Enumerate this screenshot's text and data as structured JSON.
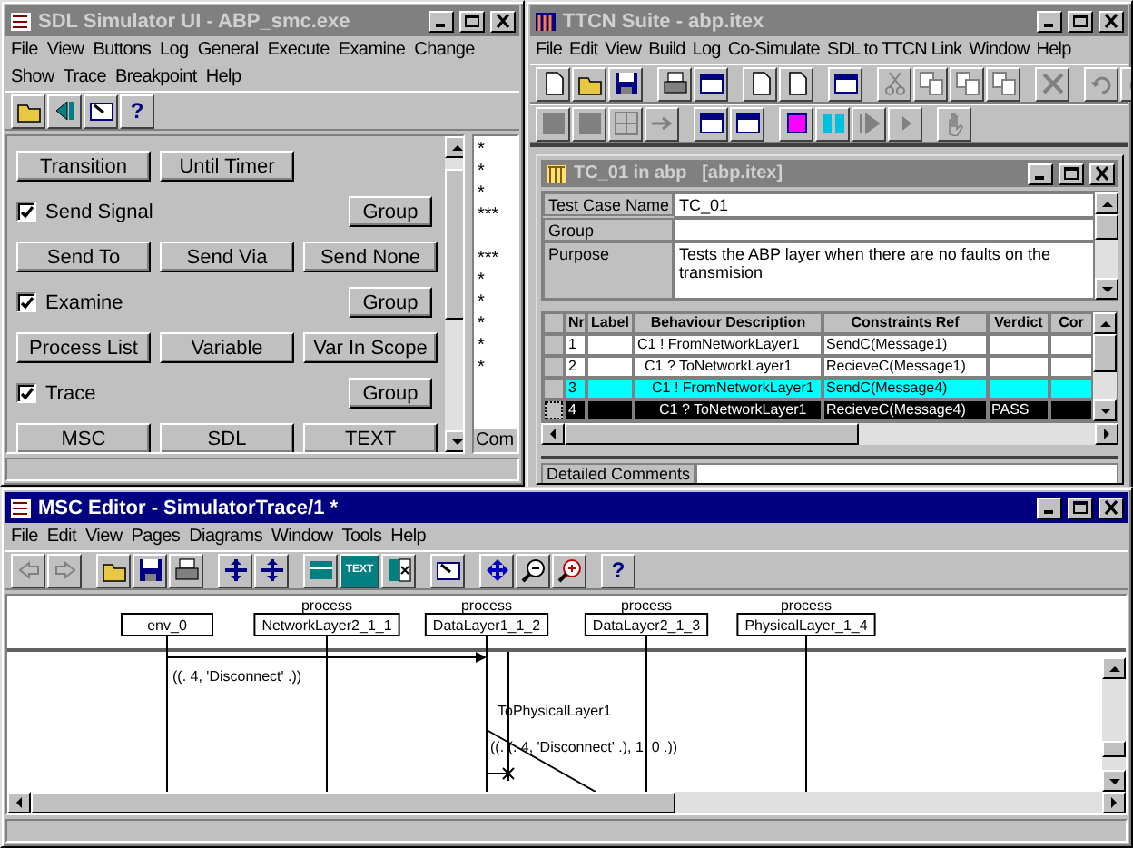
{
  "sdl_window": {
    "title": "SDL Simulator UI - ABP_smc.exe",
    "menu_rows": [
      [
        "File",
        "View",
        "Buttons",
        "Log",
        "General",
        "Execute",
        "Examine",
        "Change"
      ],
      [
        "Show",
        "Trace",
        "Breakpoint",
        "Help"
      ]
    ],
    "help_glyph": "?",
    "rows": [
      {
        "kind": "buttons",
        "buttons": [
          "Transition",
          "Until Timer"
        ]
      },
      {
        "kind": "check",
        "label": "Send Signal",
        "checked": true,
        "button": "Group"
      },
      {
        "kind": "buttons",
        "buttons": [
          "Send To",
          "Send Via",
          "Send None"
        ]
      },
      {
        "kind": "check",
        "label": "Examine",
        "checked": true,
        "button": "Group"
      },
      {
        "kind": "buttons",
        "buttons": [
          "Process List",
          "Variable",
          "Var In Scope"
        ]
      },
      {
        "kind": "check",
        "label": "Trace",
        "checked": true,
        "button": "Group"
      },
      {
        "kind": "buttons",
        "buttons": [
          "MSC",
          "SDL",
          "TEXT"
        ]
      }
    ],
    "log_text": "*\n*\n*\n***\n\n***\n*\n*\n*\n*\n*",
    "log_tab": "Com"
  },
  "ttcn_window": {
    "title": "TTCN Suite - abp.itex",
    "menu": [
      "File",
      "Edit",
      "View",
      "Build",
      "Log",
      "Co-Simulate",
      "SDL to TTCN Link",
      "Window",
      "Help"
    ],
    "test_case": {
      "title": "TC_01 in abp   [abp.itex]",
      "fields": [
        {
          "label": "Test Case Name",
          "value": "TC_01"
        },
        {
          "label": "Group"
        },
        {
          "label": "Purpose",
          "value": "Tests the ABP layer when there are no faults on the transmision"
        }
      ],
      "columns": [
        "Nr",
        "Label",
        "Behaviour Description",
        "Constraints Ref",
        "Verdict",
        "Cor"
      ],
      "rows": [
        {
          "nr": "1",
          "behaviour": "C1 ! FromNetworkLayer1",
          "constraints": "SendC(Message1)",
          "selected": false,
          "marked": false,
          "children": [
            {
              "nr": "2",
              "behaviour": "C1 ? ToNetworkLayer1",
              "constraints": "RecieveC(Message1)",
              "selected": false,
              "marked": false,
              "children": [
                {
                  "nr": "3",
                  "behaviour": "C1 ! FromNetworkLayer1",
                  "constraints": "SendC(Message4)",
                  "selected": false,
                  "marked": true,
                  "children": [
                    {
                      "nr": "4",
                      "behaviour": "C1 ? ToNetworkLayer1",
                      "constraints": "RecieveC(Message4)",
                      "verdict": "PASS",
                      "selected": true,
                      "marked": false
                    }
                  ]
                }
              ]
            }
          ]
        }
      ],
      "comments_label": "Detailed Comments"
    }
  },
  "msc_window": {
    "title": "MSC Editor - SimulatorTrace/1 *",
    "menu": [
      "File",
      "Edit",
      "View",
      "Pages",
      "Diagrams",
      "Window",
      "Tools",
      "Help"
    ],
    "text_tool_label": "TEXT",
    "help_glyph": "?",
    "instances": [
      {
        "name": "env_0"
      },
      {
        "type": "process",
        "name": "NetworkLayer2_1_1"
      },
      {
        "type": "process",
        "name": "DataLayer1_1_2"
      },
      {
        "type": "process",
        "name": "DataLayer2_1_3"
      },
      {
        "type": "process",
        "name": "PhysicalLayer_1_4"
      }
    ],
    "messages": [
      {
        "kind": "horizontal",
        "params": "((. 4, 'Disconnect' .))"
      },
      {
        "kind": "sloped",
        "name": "ToPhysicalLayer1",
        "params": "((. (. 4, 'Disconnect' .), 1, 0 .))"
      }
    ]
  }
}
